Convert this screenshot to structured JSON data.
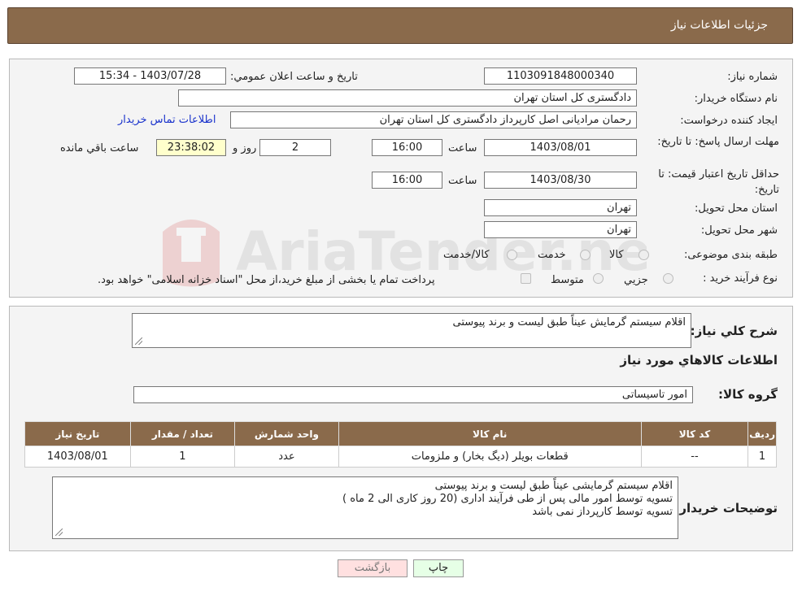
{
  "header": {
    "title": "جزئیات اطلاعات نیاز"
  },
  "info": {
    "need_number_label": "شماره نیاز:",
    "need_number": "1103091848000340",
    "announce_label": "تاریخ و ساعت اعلان عمومي:",
    "announce_value": "1403/07/28 - 15:34",
    "buyer_label": "نام دستگاه خريدار:",
    "buyer_value": "دادگستری کل استان تهران",
    "creator_label": "ايجاد کننده درخواست:",
    "creator_value": "رحمان مرادیانی اصل کارپرداز دادگستری کل استان تهران",
    "contact_link": "اطلاعات تماس خريدار",
    "deadline_label": "مهلت ارسال پاسخ: تا تاريخ:",
    "deadline_date": "1403/08/01",
    "time_label": "ساعت",
    "deadline_time": "16:00",
    "days_value": "2",
    "days_label": "روز و",
    "remaining_time": "23:38:02",
    "remaining_label": "ساعت باقي مانده",
    "validity_label": "حداقل تاريخ اعتبار قيمت: تا تاريخ:",
    "validity_date": "1403/08/30",
    "validity_time": "16:00",
    "province_label": "استان محل تحويل:",
    "province_value": "تهران",
    "city_label": "شهر محل تحويل:",
    "city_value": "تهران",
    "category_label": "طبقه بندی موضوعی:",
    "category_options": [
      "کالا",
      "خدمت",
      "کالا/خدمت"
    ],
    "process_label": "نوع فرآيند خريد :",
    "process_options": [
      "جزيي",
      "متوسط"
    ],
    "process_note": "پرداخت تمام يا بخشی از مبلغ خريد،از محل \"اسناد خزانه اسلامی\" خواهد بود."
  },
  "details": {
    "summary_label": "شرح کلي نياز:",
    "summary_value": "اقلام سیستم گرمایش  عیناً طبق لیست و برند پیوستی",
    "goods_info_title": "اطلاعات کالاهاي مورد نياز",
    "group_label": "گروه کالا:",
    "group_value": "امور تاسیساتی",
    "table": {
      "headers": [
        "رديف",
        "کد کالا",
        "نام کالا",
        "واحد شمارش",
        "تعداد / مقدار",
        "تاريخ نياز"
      ],
      "rows": [
        [
          "1",
          "--",
          "قطعات بویلر (دیگ بخار) و ملزومات",
          "عدد",
          "1",
          "1403/08/01"
        ]
      ]
    },
    "buyer_notes_label": "توضيحات خريدار:",
    "buyer_notes_lines": [
      "اقلام سیستم گرمایشی  عیناً طبق لیست و برند پیوستی",
      " تسویه توسط امور مالی پس از طی فرآیند اداری (20 روز کاری  الی 2 ماه )",
      "تسویه توسط کارپرداز نمی باشد"
    ]
  },
  "buttons": {
    "print": "چاپ",
    "back": "بازگشت"
  },
  "watermark": {
    "text": "AriaTender.neT"
  },
  "colors": {
    "header": "#8a6a4b",
    "link": "#1a33cc",
    "back_button": "#ffe0e0",
    "print_button": "#e6ffe6",
    "remaining_bg": "#ffffcc"
  }
}
